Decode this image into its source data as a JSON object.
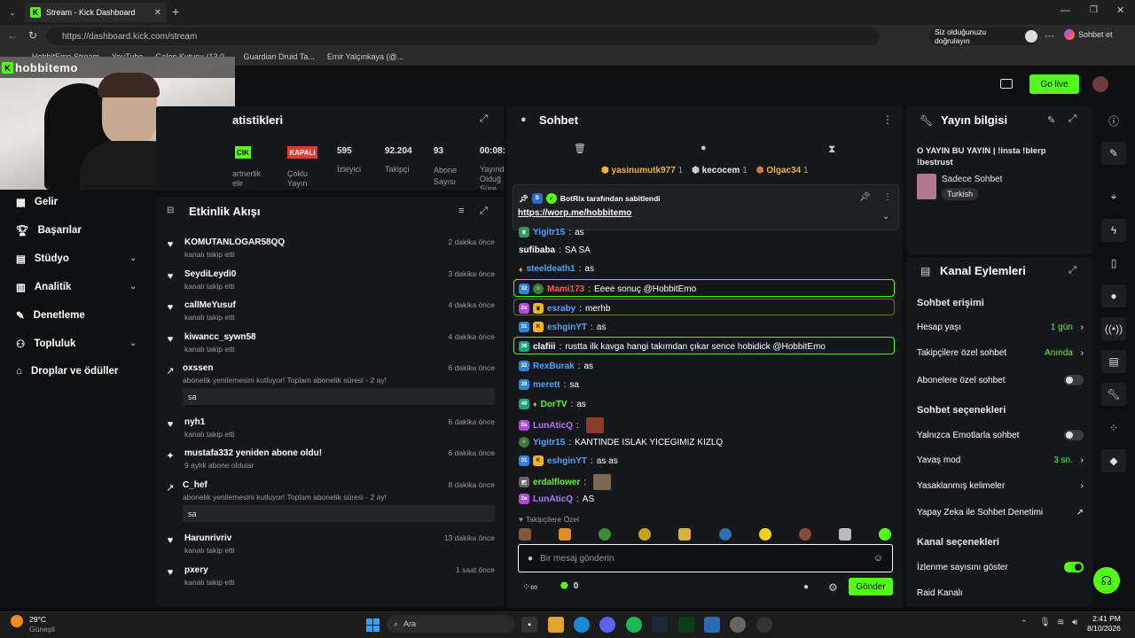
{
  "browser": {
    "tab_title": "Stream - Kick Dashboard",
    "url": "https://dashboard.kick.com/stream",
    "verify_label": "Siz olduğunuzu doğrulayın",
    "copilot_label": "Sohbet et",
    "bookmarks": [
      "HobbitEmo Stream",
      "YouTube",
      "Gelen Kutusu (13.0...",
      "Guardian Druid Ta...",
      "Emir Yalçınkaya (@..."
    ]
  },
  "app": {
    "channel_name": "hobbitemo",
    "go_live": "Go live",
    "accent": "#53fc18"
  },
  "stats": {
    "title": "atistikleri",
    "items": [
      {
        "value": "CIK",
        "label": "artnerlik\nelir"
      },
      {
        "value": "KAPALI",
        "label": "Çoklu\nYayın"
      },
      {
        "value": "595",
        "label": "İzleyici"
      },
      {
        "value": "92.204",
        "label": "Takipçi"
      },
      {
        "value": "93",
        "label": "Abone\nSayısı"
      },
      {
        "value": "00:08:",
        "label": "Yayınd\nOlduğ\nSüre"
      }
    ]
  },
  "sidebar": {
    "items": [
      {
        "label": "Gelir"
      },
      {
        "label": "Başarılar"
      },
      {
        "label": "Stüdyo"
      },
      {
        "label": "Analitik"
      },
      {
        "label": "Denetleme"
      },
      {
        "label": "Topluluk"
      },
      {
        "label": "Droplar ve ödüller"
      }
    ]
  },
  "activity": {
    "title": "Etkinlik Akışı",
    "items": [
      {
        "name": "KOMUTANLOGAR58QQ",
        "sub": "kanalı takip etti",
        "time": "2 dakika önce"
      },
      {
        "name": "SeydiLeydi0",
        "sub": "kanalı takip etti",
        "time": "3 dakika önce"
      },
      {
        "name": "callMeYusuf",
        "sub": "kanalı takip etti",
        "time": "4 dakika önce"
      },
      {
        "name": "kiwancc_sywn58",
        "sub": "kanalı takip etti",
        "time": "4 dakika önce"
      },
      {
        "name": "oxssen",
        "sub": "abonelik yenilemesini kutluyor! Toplam abonelik süresi - 2 ay!",
        "time": "6 dakika önce",
        "msg": "sa"
      },
      {
        "name": "nyh1",
        "sub": "kanalı takip etti",
        "time": "6 dakika önce"
      },
      {
        "name": "mustafa332 yeniden abone oldu!",
        "sub": "9 aylık abone oldular",
        "time": "6 dakika önce"
      },
      {
        "name": "C_hef",
        "sub": "abonelik yenilemesini kutluyor! Toplam abonelik süresi - 2 ay!",
        "time": "8 dakika önce",
        "msg": "sa"
      },
      {
        "name": "Harunrivriv",
        "sub": "kanalı takip etti",
        "time": "13 dakika önce"
      },
      {
        "name": "pxery",
        "sub": "kanalı takip etti",
        "time": "1 saat önce"
      }
    ]
  },
  "chat": {
    "title": "Sohbet",
    "top_gifters": [
      {
        "name": "yasinumutk977",
        "count": "1"
      },
      {
        "name": "kecocem",
        "count": "1"
      },
      {
        "name": "Olgac34",
        "count": "1"
      }
    ],
    "pinned_by": "BotRix tarafından sabitlendi",
    "pinned_link": "https://worp.me/hobbitemo",
    "messages": [
      {
        "user": "Yigitr15",
        "text": "as",
        "color": "#4fa3ff"
      },
      {
        "user": "sufibaba",
        "text": "SA SA",
        "color": "#ffffff"
      },
      {
        "user": "steeldeath1",
        "text": "as",
        "color": "#4fa3ff"
      },
      {
        "user": "Mami173",
        "text": "Eeee sonuç @HobbitEmo",
        "color": "#ff5a5a"
      },
      {
        "user": "esraby",
        "text": "merhb",
        "color": "#4fa3ff"
      },
      {
        "user": "eshginYT",
        "text": "as",
        "color": "#4fa3ff"
      },
      {
        "user": "clafiii",
        "text": "rustta ilk kavga hangi takımdan çıkar sence hobidick @HobbitEmo",
        "color": "#ffffff"
      },
      {
        "user": "RexBurak",
        "text": "as",
        "color": "#4fa3ff"
      },
      {
        "user": "merett",
        "text": "sa",
        "color": "#4fa3ff"
      },
      {
        "user": "DorTV",
        "text": "as",
        "color": "#53fc18"
      },
      {
        "user": "LunAticQ",
        "text": "",
        "color": "#b07bff"
      },
      {
        "user": "Yigitr15",
        "text": "KANTINDE ISLAK YICEGIMIZ KIZLQ",
        "color": "#4fa3ff"
      },
      {
        "user": "eshginYT",
        "text": "as as",
        "color": "#4fa3ff"
      },
      {
        "user": "erdalflower",
        "text": "",
        "color": "#53fc18"
      },
      {
        "user": "LunAticQ",
        "text": "AS",
        "color": "#b07bff"
      }
    ],
    "followers_only": "Takipçilere Özel",
    "input_placeholder": "Bir mesaj gönderin",
    "points": "0",
    "send": "Gönder"
  },
  "stream_info": {
    "title": "Yayın bilgisi",
    "stream_title": "O YAYIN BU YAYIN | !insta !blerp !bestrust",
    "category": "Sadece Sohbet",
    "language": "Turkish"
  },
  "channel_actions": {
    "title": "Kanal Eylemleri",
    "chat_access": "Sohbet erişimi",
    "account_age": "Hesap yaşı",
    "account_age_value": "1 gün",
    "followers_only": "Takipçilere özel sohbet",
    "followers_only_value": "Anında",
    "subs_only": "Abonelere özel sohbet",
    "chat_options": "Sohbet seçenekleri",
    "emote_only": "Yalnızca Emotlarla sohbet",
    "slow_mode": "Yavaş mod",
    "slow_mode_value": "3 sn.",
    "banned_words": "Yasaklanmış kelimeler",
    "ai_moderation": "Yapay Zeka ile Sohbet Denetimi",
    "channel_options": "Kanal seçenekleri",
    "show_viewers": "İzlenme sayısını göster",
    "raid": "Raid Kanalı"
  },
  "taskbar": {
    "weather_temp": "29°C",
    "weather_label": "Güneşli",
    "search": "Ara",
    "time": "2:41 PM",
    "date": "8/10/2026"
  }
}
